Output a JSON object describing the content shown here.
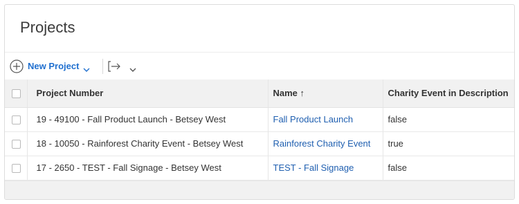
{
  "page": {
    "title": "Projects"
  },
  "toolbar": {
    "new_project_label": "New Project",
    "new_icon": "plus-circle-icon",
    "export_icon": "export-arrow-icon"
  },
  "table": {
    "columns": [
      "Project Number",
      "Name ↑",
      "Charity Event in Description"
    ],
    "rows": [
      {
        "number": "19 - 49100 - Fall Product Launch - Betsey West",
        "name": "Fall Product Launch",
        "charity": "false"
      },
      {
        "number": "18 - 10050 - Rainforest Charity Event - Betsey West",
        "name": "Rainforest Charity Event",
        "charity": "true"
      },
      {
        "number": "17 - 2650 - TEST - Fall Signage - Betsey West",
        "name": "TEST - Fall Signage",
        "charity": "false"
      }
    ]
  },
  "colors": {
    "link": "#1f5fb0",
    "accent": "#1f6fcf",
    "header_bg": "#f1f1f1"
  }
}
